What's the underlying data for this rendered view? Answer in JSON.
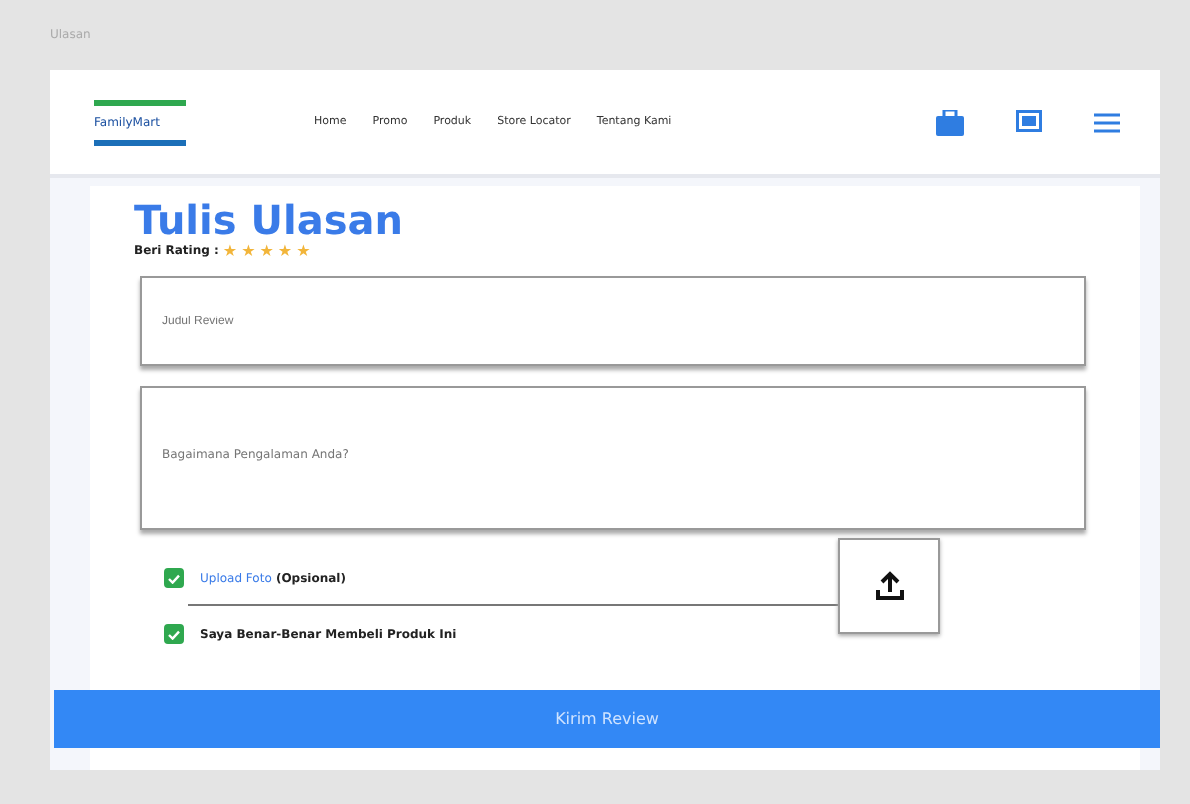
{
  "frame_label": "Ulasan",
  "navbar": {
    "logo": "FamilyMart",
    "links": [
      "Home",
      "Promo",
      "Produk",
      "Store Locator",
      "Tentang Kami"
    ]
  },
  "review": {
    "title": "Tulis Ulasan",
    "rating_label": "Beri Rating :",
    "stars": 5,
    "fields": [
      {
        "kind": "line",
        "placeholder": "Judul Review"
      },
      {
        "kind": "area",
        "placeholder": "Bagaimana Pengalaman Anda?"
      }
    ],
    "checks": [
      {
        "link": "Upload Foto",
        "text": "(Opsional)",
        "checked": true
      },
      {
        "text": "Saya Benar-Benar Membeli Produk Ini",
        "checked": true
      }
    ],
    "submit": "Kirim Review"
  }
}
